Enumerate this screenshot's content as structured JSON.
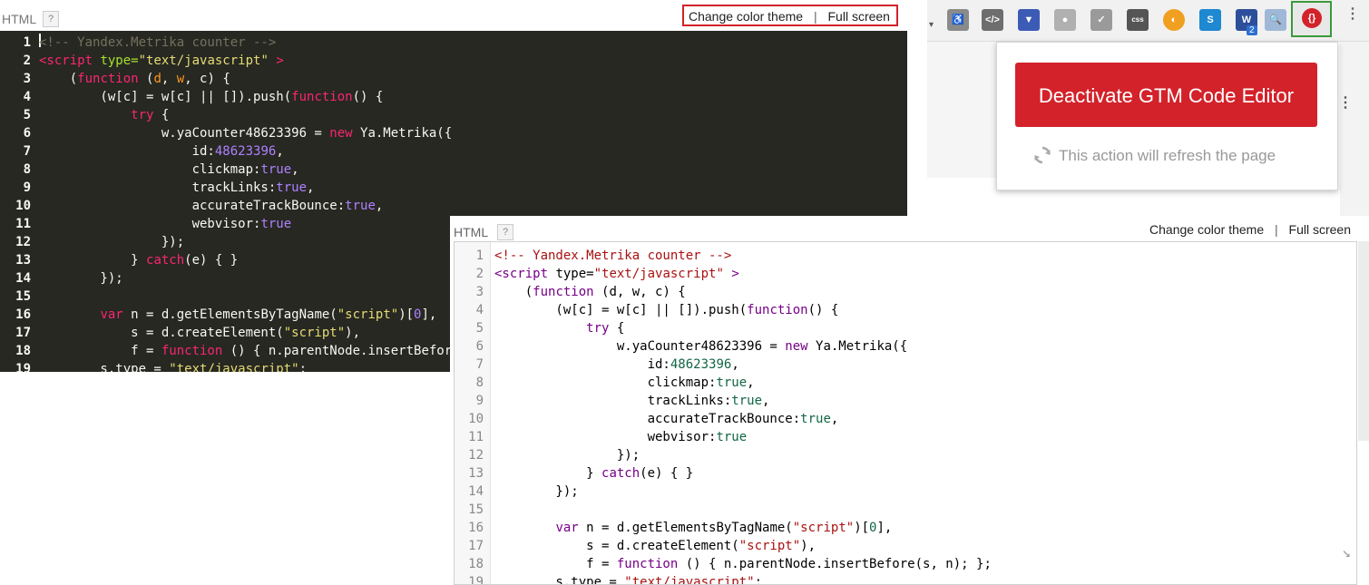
{
  "panel_dark": {
    "lang_label": "HTML",
    "help_label": "?",
    "change_theme": "Change color theme",
    "separator": "|",
    "full_screen": "Full screen"
  },
  "panel_light": {
    "lang_label": "HTML",
    "help_label": "?",
    "change_theme": "Change color theme",
    "separator": "|",
    "full_screen": "Full screen"
  },
  "extension_popup": {
    "deactivate_label": "Deactivate GTM Code Editor",
    "refresh_note": "This action will refresh the page",
    "active_icon_text": "{}",
    "toolbar_badge": "2"
  },
  "code_lines": [
    {
      "n": "1",
      "t": "<!-- Yandex.Metrika counter -->"
    },
    {
      "n": "2",
      "t": "<script type=\"text/javascript\" >"
    },
    {
      "n": "3",
      "t": "    (function (d, w, c) {"
    },
    {
      "n": "4",
      "t": "        (w[c] = w[c] || []).push(function() {"
    },
    {
      "n": "5",
      "t": "            try {"
    },
    {
      "n": "6",
      "t": "                w.yaCounter48623396 = new Ya.Metrika({"
    },
    {
      "n": "7",
      "t": "                    id:48623396,"
    },
    {
      "n": "8",
      "t": "                    clickmap:true,"
    },
    {
      "n": "9",
      "t": "                    trackLinks:true,"
    },
    {
      "n": "10",
      "t": "                    accurateTrackBounce:true,"
    },
    {
      "n": "11",
      "t": "                    webvisor:true"
    },
    {
      "n": "12",
      "t": "                });"
    },
    {
      "n": "13",
      "t": "            } catch(e) { }"
    },
    {
      "n": "14",
      "t": "        });"
    },
    {
      "n": "15",
      "t": ""
    },
    {
      "n": "16",
      "t": "        var n = d.getElementsByTagName(\"script\")[0],"
    },
    {
      "n": "17",
      "t": "            s = d.createElement(\"script\"),"
    },
    {
      "n": "18",
      "t": "            f = function () { n.parentNode.insertBefore(s, n); };"
    },
    {
      "n": "19",
      "t": "        s.type = \"text/javascript\";"
    }
  ]
}
